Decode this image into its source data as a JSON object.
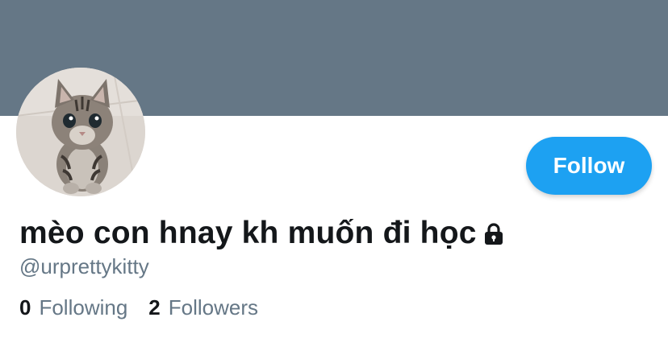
{
  "colors": {
    "banner": "#657786",
    "accent": "#1da1f2",
    "text_primary": "#14171a",
    "text_secondary": "#657786"
  },
  "profile": {
    "display_name": "mèo con hnay kh muốn đi học",
    "handle": "@urprettykitty",
    "protected_icon": "lock-icon",
    "avatar_icon": "kitten-photo"
  },
  "actions": {
    "follow_label": "Follow"
  },
  "stats": {
    "following_count": "0",
    "following_label": "Following",
    "followers_count": "2",
    "followers_label": "Followers"
  }
}
